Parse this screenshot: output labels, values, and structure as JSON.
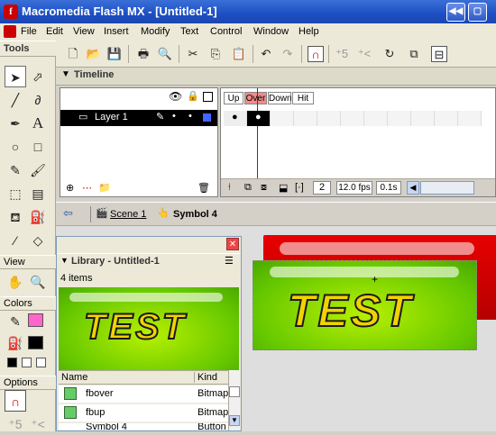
{
  "window": {
    "title": "Macromedia Flash MX - [Untitled-1]",
    "app_icon": "flash-icon"
  },
  "menubar": [
    "File",
    "Edit",
    "View",
    "Insert",
    "Modify",
    "Text",
    "Control",
    "Window",
    "Help"
  ],
  "tools_panel": {
    "title": "Tools",
    "view_title": "View",
    "colors_title": "Colors",
    "options_title": "Options",
    "stroke_color": "#ff66cc",
    "fill_color": "#000000"
  },
  "timeline": {
    "title": "Timeline",
    "layer_name": "Layer 1",
    "frame_labels": [
      "Up",
      "Over",
      "Down",
      "Hit"
    ],
    "current_frame": "2",
    "fps": "12.0 fps",
    "time": "0.1s"
  },
  "editbar": {
    "scene": "Scene 1",
    "symbol": "Symbol 4"
  },
  "library": {
    "title": "Library - Untitled-1",
    "count": "4 items",
    "columns": [
      "Name",
      "Kind"
    ],
    "preview_text": "TEST",
    "items": [
      {
        "name": "fbover",
        "kind": "Bitmap"
      },
      {
        "name": "fbup",
        "kind": "Bitmap"
      },
      {
        "name": "Symbol 4",
        "kind": "Button"
      }
    ]
  },
  "stage": {
    "button_text": "TEST",
    "green": "#6fd100",
    "red": "#d40000"
  }
}
